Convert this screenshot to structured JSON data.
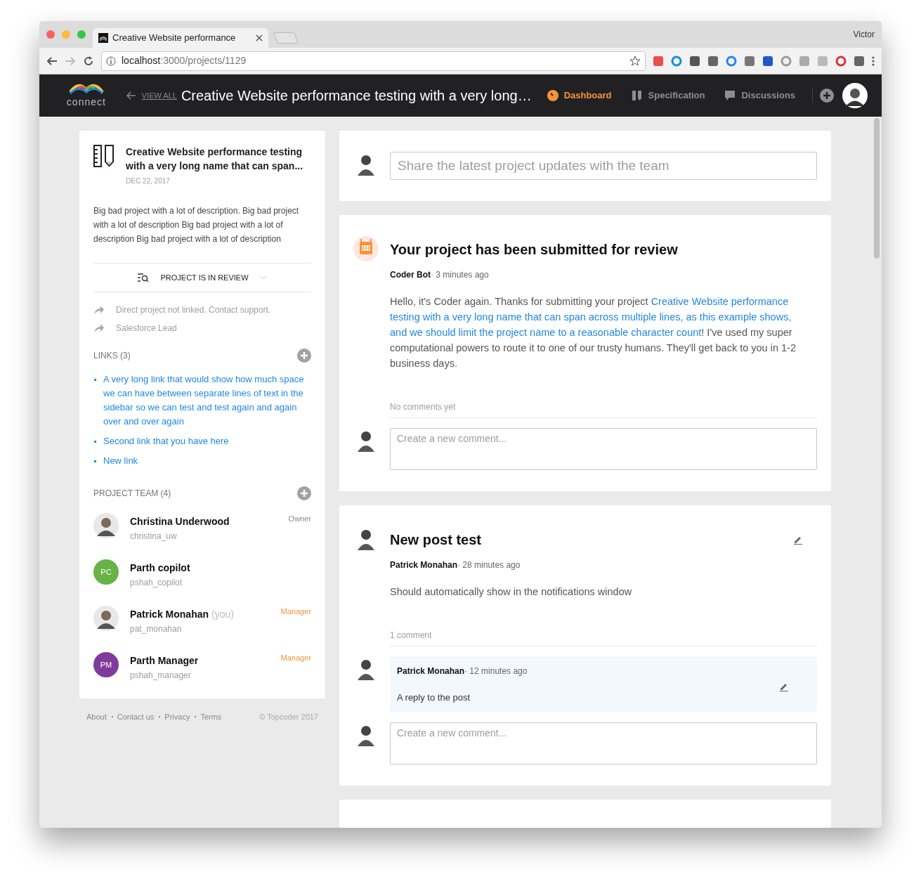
{
  "browser": {
    "tab_title": "Creative Website performance",
    "url_host": "localhost",
    "url_path": ":3000/projects/1129",
    "user": "Victor"
  },
  "header": {
    "logo_text": "connect",
    "back_label": "VIEW ALL",
    "project_title": "Creative Website performance testing with a very long…",
    "nav": [
      {
        "label": "Dashboard",
        "kind": "dashboard",
        "selected": true
      },
      {
        "label": "Specification",
        "kind": "specification",
        "selected": false
      },
      {
        "label": "Discussions",
        "kind": "discussions",
        "selected": false
      }
    ]
  },
  "sidebar": {
    "project": {
      "title": "Creative Website performance testing with a very long name that can span...",
      "date": "DEC 22, 2017",
      "description": "Big bad project with a lot of description. Big bad project with a lot of description Big bad project with a lot of description Big bad project with a lot of description"
    },
    "status": "PROJECT IS IN REVIEW",
    "info_items": [
      "Direct project not linked. Contact support.",
      "Salesforce Lead"
    ],
    "links": {
      "heading": "LINKS (3)",
      "items": [
        "A very long link that would show how much space we can have between separate lines of text in the sidebar so we can test and test again and again over and over again",
        "Second link that you have here",
        "New link"
      ]
    },
    "team": {
      "heading": "PROJECT TEAM (4)",
      "members": [
        {
          "name": "Christina Underwood",
          "username": "christina_uw",
          "role": "Owner",
          "role_highlighted": false,
          "avatar": {
            "kind": "photo"
          }
        },
        {
          "name": "Parth copilot",
          "username": "pshah_copilot",
          "avatar": {
            "kind": "initials",
            "initials": "PC",
            "color": "#67b346"
          }
        },
        {
          "name": "Patrick Monahan",
          "you_label": "(you)",
          "username": "pat_monahan",
          "role": "Manager",
          "role_highlighted": true,
          "avatar": {
            "kind": "photo"
          }
        },
        {
          "name": "Parth Manager",
          "username": "pshah_manager",
          "role": "Manager",
          "role_highlighted": true,
          "avatar": {
            "kind": "initials",
            "initials": "PM",
            "color": "#7f3b9c"
          }
        }
      ]
    }
  },
  "footer": {
    "links": [
      "About",
      "Contact us",
      "Privacy",
      "Terms"
    ],
    "copyright": "© Topcoder 2017"
  },
  "composer": {
    "placeholder": "Share the latest project updates with the team"
  },
  "posts": [
    {
      "kind": "bot",
      "title": "Your project has been submitted for review",
      "author": "Coder Bot",
      "time": "· 3 minutes ago",
      "editable": false,
      "body": [
        {
          "text": "Hello, it's Coder again. Thanks for submitting your project ",
          "link": false
        },
        {
          "text": "Creative Website performance",
          "link": true
        },
        {
          "text": "testing with a very long name that can span across multiple lines, as this example shows,",
          "link": true
        },
        {
          "text": "and we should limit the project name to a reasonable character count",
          "link": true
        },
        {
          "text": "! I've used my super computational powers to route it to one of our trusty humans. They'll get back to you in 1-2 business days.",
          "link": false
        }
      ],
      "comments_label": "No comments yet",
      "comment_placeholder": "Create a new comment..."
    },
    {
      "kind": "user",
      "title": "New post test",
      "author": "Patrick Monahan",
      "time": "· 28 minutes ago",
      "editable": true,
      "body": [
        {
          "text": "Should automatically show in the notifications window",
          "link": false
        }
      ],
      "comments_label": "1 comment",
      "comments": [
        {
          "author": "Patrick Monahan",
          "time": "· 12 minutes ago",
          "text": "A reply to the post",
          "editable": true
        }
      ],
      "comment_placeholder": "Create a new comment..."
    }
  ]
}
